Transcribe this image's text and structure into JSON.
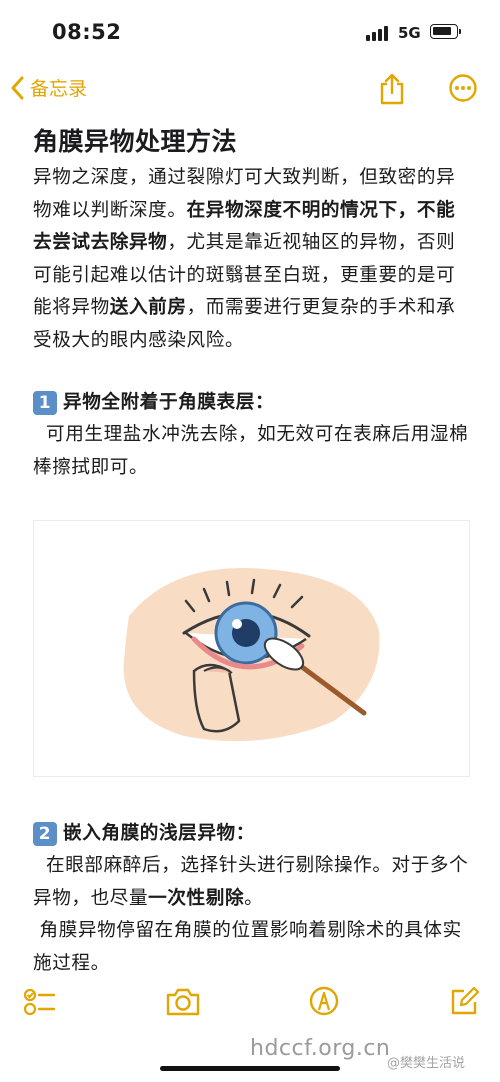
{
  "status_bar": {
    "time": "08:52",
    "network": "5G"
  },
  "nav": {
    "back_label": "备忘录"
  },
  "note": {
    "title": "角膜异物处理方法",
    "intro": [
      {
        "t": "异物之深度，通过裂隙灯可大致判断，但致密的异物难以判断深度。",
        "b": false
      },
      {
        "t": "在异物深度不明的情况下，不能去尝试去除异物",
        "b": true
      },
      {
        "t": "，尤其是靠近视轴区的异物，否则可能引起难以估计的斑翳甚至白斑，更重要的是可能将异物",
        "b": false
      },
      {
        "t": "送入前房",
        "b": true
      },
      {
        "t": "，而需要进行更复杂的手术和承受极大的眼内感染风险。",
        "b": false
      }
    ],
    "section1": {
      "number": "1",
      "heading": "异物全附着于角膜表层：",
      "body": "  可用生理盐水冲洗去除，如无效可在表麻后用湿棉棒擦拭即可。"
    },
    "section2": {
      "number": "2",
      "heading": "嵌入角膜的浅层异物：",
      "body": [
        {
          "t": "  在眼部麻醉后，选择针头进行剔除操作。对于多个异物，也尽量",
          "b": false
        },
        {
          "t": "一次性剔除",
          "b": true
        },
        {
          "t": "。",
          "b": false
        }
      ],
      "body2": " 角膜异物停留在角膜的位置影响着剔除术的具体实施过程。"
    }
  },
  "watermark": {
    "main": "hdccf.org.cn",
    "small": "@樊樊生活说"
  },
  "colors": {
    "accent": "#e1a600",
    "badge": "#5a8fc8",
    "text": "#1c1c1e"
  },
  "icons": {
    "nav": [
      "chevron-left-icon",
      "share-icon",
      "more-icon"
    ],
    "toolbar": [
      "checklist-icon",
      "camera-icon",
      "markup-icon",
      "compose-icon"
    ]
  }
}
